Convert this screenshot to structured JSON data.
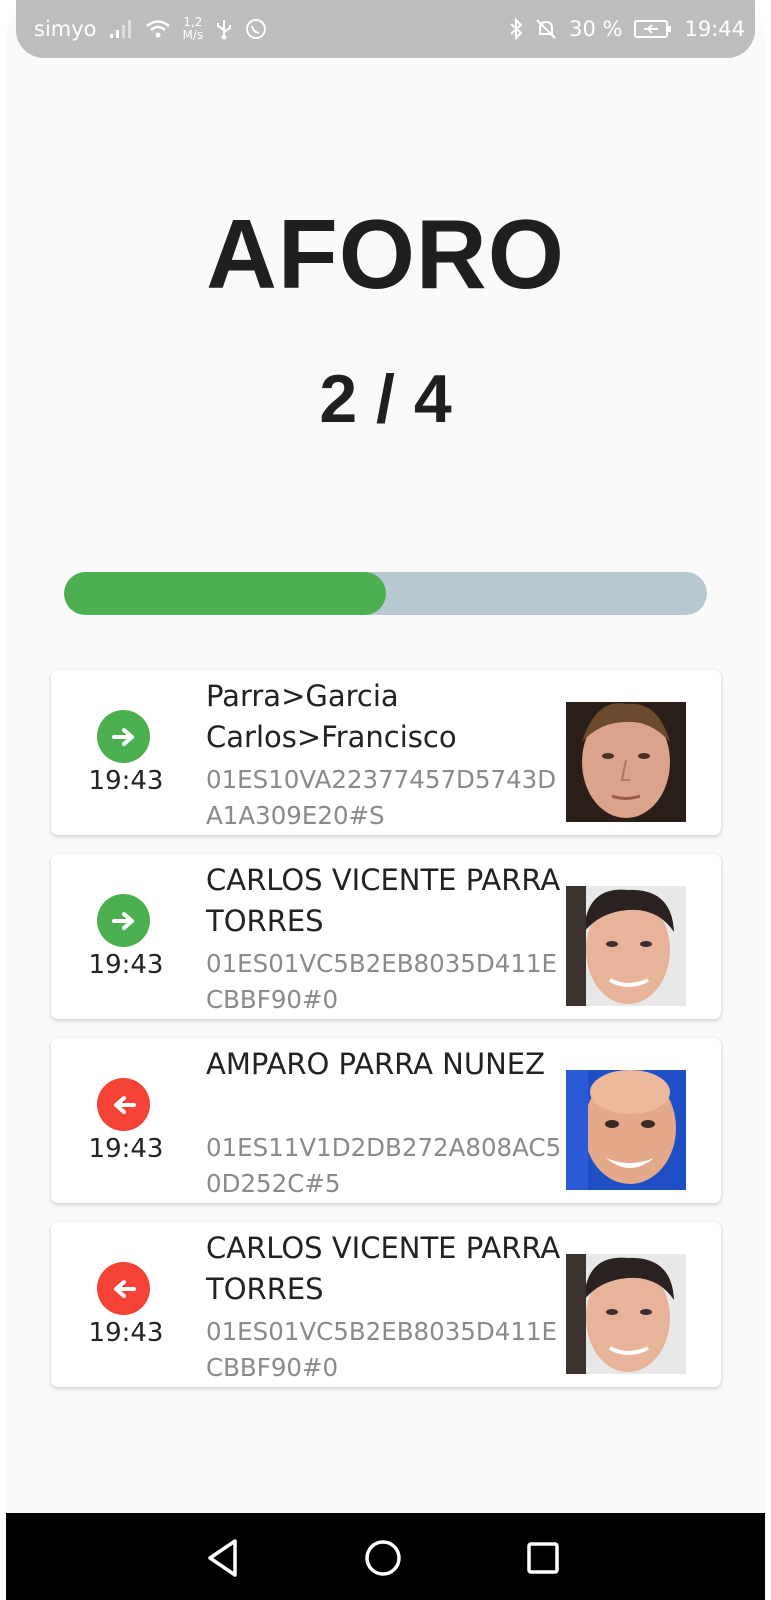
{
  "status_bar": {
    "carrier": "simyo",
    "speed_value": "1,2",
    "speed_unit": "M/s",
    "battery_percent": "30 %",
    "clock": "19:44"
  },
  "header": {
    "title": "AFORO",
    "count_current": 2,
    "count_max": 4,
    "count_label": "2 / 4"
  },
  "progress": {
    "fraction": 0.5,
    "fill_color": "#4caf50",
    "track_color": "#b8c8d0"
  },
  "entries": [
    {
      "direction": "in",
      "direction_icon": "arrow-right-icon",
      "time": "19:43",
      "name": "Parra>Garcia Carlos>Francisco",
      "code": "01ES10VA22377457D5743DA1A309E20#S",
      "photo": "person-photo"
    },
    {
      "direction": "in",
      "direction_icon": "arrow-right-icon",
      "time": "19:43",
      "name": "CARLOS VICENTE PARRA TORRES",
      "code": "01ES01VC5B2EB8035D411ECBBF90#0",
      "photo": "person-photo"
    },
    {
      "direction": "out",
      "direction_icon": "arrow-left-icon",
      "time": "19:43",
      "name": "AMPARO  PARRA NUNEZ",
      "code": "01ES11V1D2DB272A808AC50D252C#5",
      "photo": "person-photo"
    },
    {
      "direction": "out",
      "direction_icon": "arrow-left-icon",
      "time": "19:43",
      "name": "CARLOS VICENTE PARRA TORRES",
      "code": "01ES01VC5B2EB8035D411ECBBF90#0",
      "photo": "person-photo"
    }
  ],
  "colors": {
    "in": "#4caf50",
    "out": "#f44336"
  },
  "nav": {
    "back_icon": "back-triangle-icon",
    "home_icon": "home-circle-icon",
    "recents_icon": "recents-square-icon"
  }
}
